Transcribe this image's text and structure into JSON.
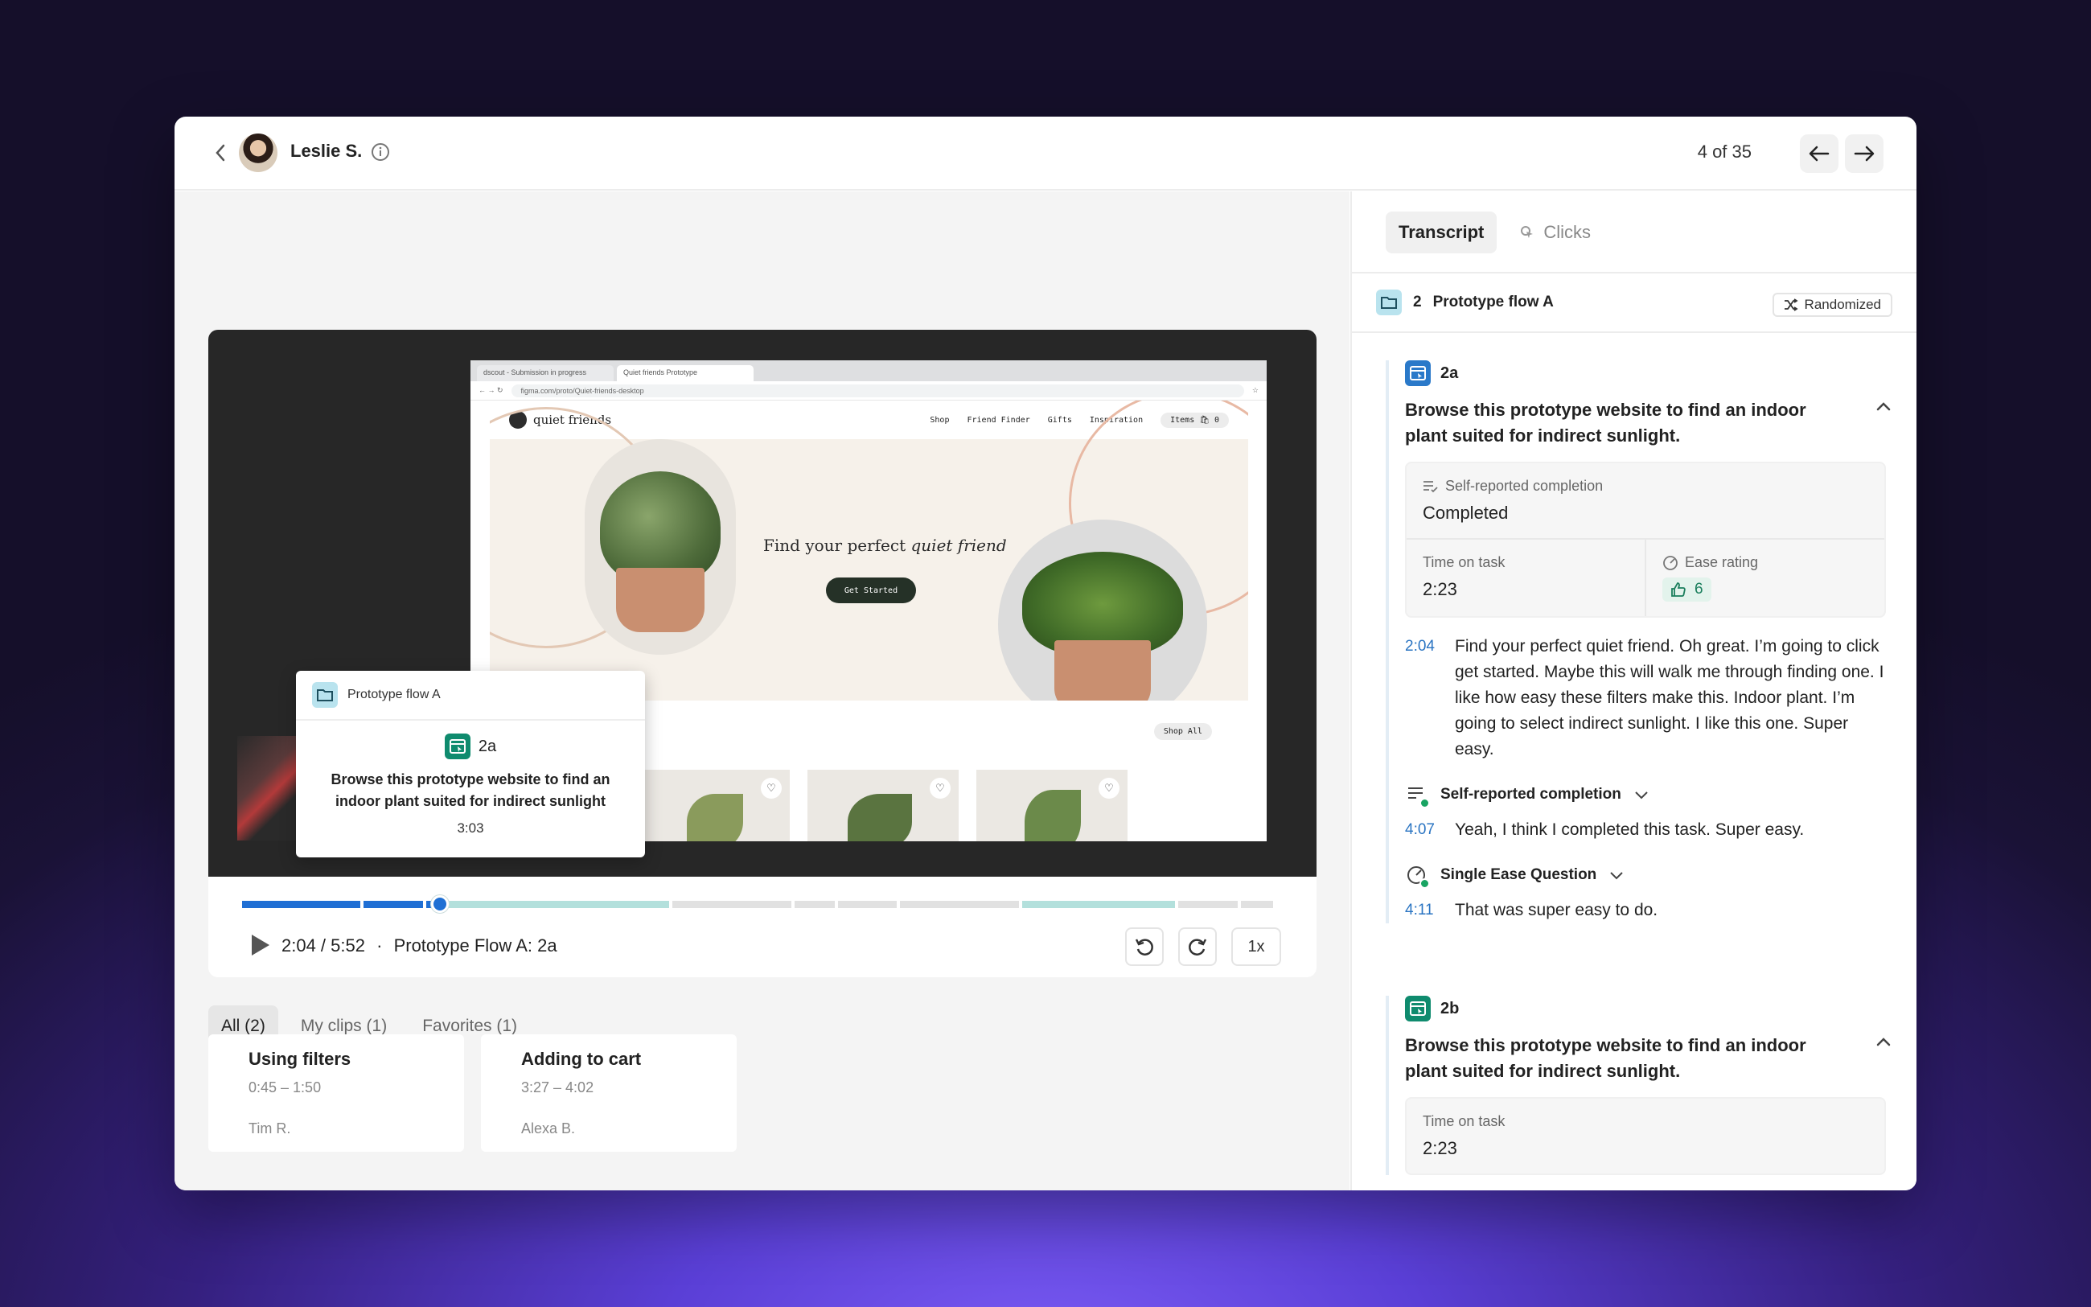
{
  "header": {
    "user_name": "Leslie S.",
    "pager": "4 of 35"
  },
  "video": {
    "browser_tabs": [
      "dscout - Submission in progress",
      "Quiet friends Prototype"
    ],
    "url": "figma.com/proto/Quiet-friends-desktop",
    "site": {
      "logo": "quiet friends",
      "nav": [
        "Shop",
        "Friend Finder",
        "Gifts",
        "Inspiration"
      ],
      "items": "Items",
      "items_count": "0",
      "hero_title_prefix": "Find your perfect ",
      "hero_title_em": "quiet friend",
      "hero_button": "Get Started",
      "shop_all": "Shop All"
    },
    "popover": {
      "flow": "Prototype flow A",
      "task_id": "2a",
      "task_text": "Browse this prototype website to find an indoor plant suited for indirect sunlight",
      "duration": "3:03"
    }
  },
  "player": {
    "progress_fraction": 0.35,
    "time": "2:04 / 5:52",
    "separator": "·",
    "label": "Prototype Flow A: 2a",
    "speed": "1x"
  },
  "clips": {
    "tabs": [
      "All (2)",
      "My clips (1)",
      "Favorites (1)"
    ],
    "cards": [
      {
        "title": "Using filters",
        "range": "0:45 – 1:50",
        "author": "Tim R."
      },
      {
        "title": "Adding to cart",
        "range": "3:27 – 4:02",
        "author": "Alexa B."
      }
    ]
  },
  "panel": {
    "tabs": [
      "Transcript",
      "Clicks"
    ],
    "section": {
      "num": "2",
      "name": "Prototype flow A",
      "badge": "Randomized"
    },
    "task_a": {
      "id": "2a",
      "title": "Browse this prototype website to find an indoor plant suited for indirect sunlight.",
      "completion_label": "Self-reported completion",
      "completion_value": "Completed",
      "time_label": "Time on task",
      "time_value": "2:23",
      "ease_label": "Ease rating",
      "ease_value": "6",
      "transcript": [
        {
          "ts": "2:04",
          "text": "Find your perfect quiet friend. Oh great. I’m going to click get started. Maybe this will walk me through finding one. I like how easy these filters make this. Indoor plant. I’m going to select indirect sunlight. I like this one. Super easy."
        }
      ],
      "q1": {
        "label": "Self-reported completion",
        "ts": "4:07",
        "text": "Yeah, I think I completed this task. Super easy."
      },
      "q2": {
        "label": "Single Ease Question",
        "ts": "4:11",
        "text": "That was super easy to do."
      }
    },
    "task_b": {
      "id": "2b",
      "title": "Browse this prototype website to find an indoor plant suited for indirect sunlight.",
      "time_label": "Time on task",
      "time_value": "2:23"
    }
  },
  "colors": {
    "accent": "#1f6fd4",
    "teal": "#0f8b6e",
    "progress_rest": "#b3e0dc"
  }
}
